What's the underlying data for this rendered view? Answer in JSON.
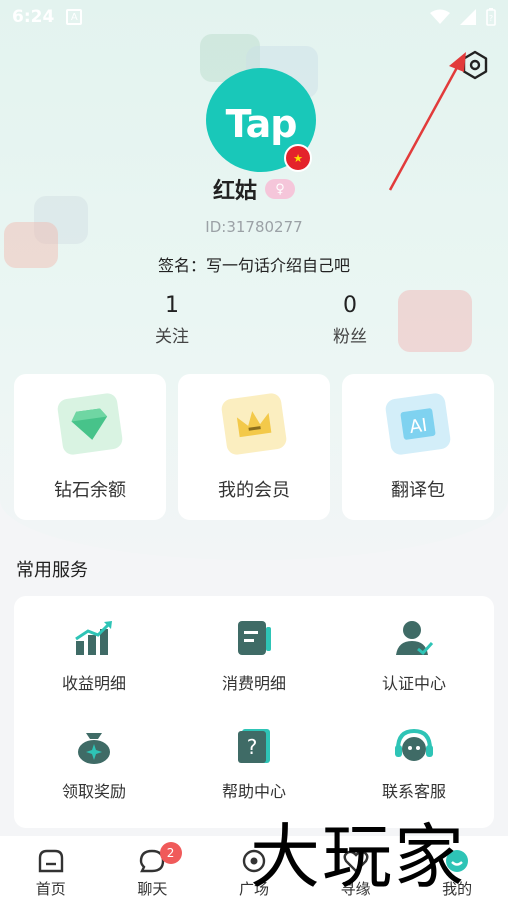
{
  "status_bar": {
    "time": "6:24",
    "notification_letter": "A"
  },
  "profile": {
    "avatar_text": "Tap",
    "username": "红姑",
    "user_id": "ID:31780277",
    "signature": "签名：写一句话介绍自己吧",
    "following_count": "1",
    "following_label": "关注",
    "fans_count": "0",
    "fans_label": "粉丝"
  },
  "quick_cards": [
    {
      "label": "钻石余额",
      "icon": "diamond-icon",
      "color": "#47c38a"
    },
    {
      "label": "我的会员",
      "icon": "crown-icon",
      "color": "#f3c94a"
    },
    {
      "label": "翻译包",
      "icon": "translate-icon",
      "color": "#4fc3e8"
    }
  ],
  "services": {
    "title": "常用服务",
    "items": [
      {
        "label": "收益明细",
        "icon": "income-chart-icon"
      },
      {
        "label": "消费明细",
        "icon": "spending-doc-icon"
      },
      {
        "label": "认证中心",
        "icon": "verify-user-icon"
      },
      {
        "label": "领取奖励",
        "icon": "reward-bag-icon"
      },
      {
        "label": "帮助中心",
        "icon": "help-book-icon"
      },
      {
        "label": "联系客服",
        "icon": "headset-icon"
      }
    ]
  },
  "bottom_nav": [
    {
      "label": "首页",
      "icon": "home-icon"
    },
    {
      "label": "聊天",
      "icon": "chat-icon",
      "badge": "2"
    },
    {
      "label": "广场",
      "icon": "plaza-icon"
    },
    {
      "label": "寻缘",
      "icon": "match-icon"
    },
    {
      "label": "我的",
      "icon": "profile-icon"
    }
  ],
  "watermark": "大玩家",
  "colors": {
    "accent": "#19c8b9",
    "icon_dark": "#3f6b66",
    "icon_teal": "#2ec4b6",
    "badge_red": "#f05a5a"
  }
}
